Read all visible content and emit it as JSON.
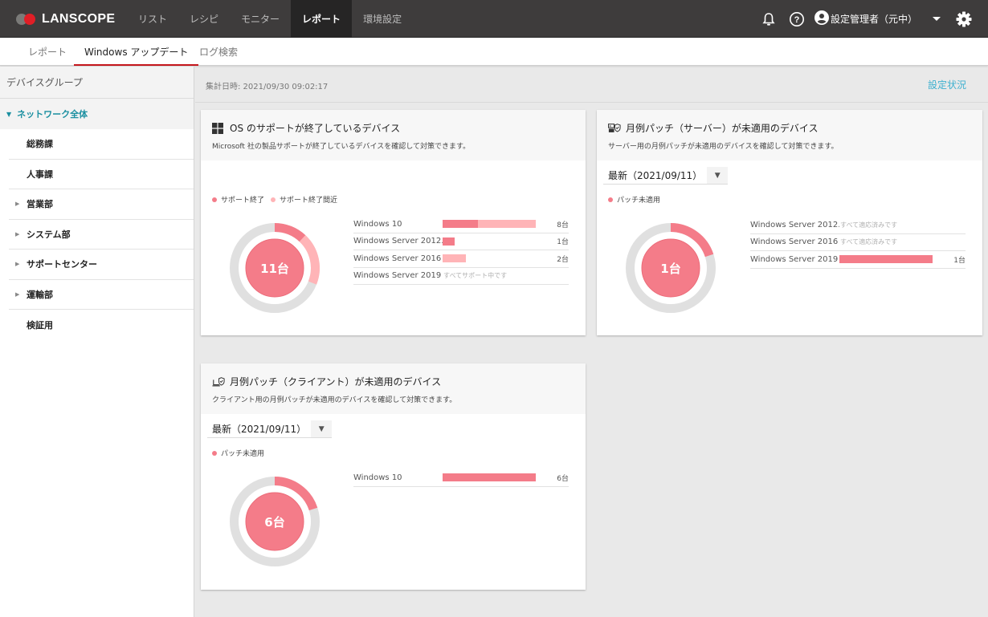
{
  "colors": {
    "ended": "#f47c89",
    "near_end": "#ffb4b7",
    "ring_bg": "#e0e0e0",
    "accent_teal": "#1a8fa0",
    "link_blue": "#3db0cf",
    "active_tab_underline": "#c4161c"
  },
  "app": {
    "logo_text": "LANSCOPE"
  },
  "nav": {
    "items": [
      {
        "label": "リスト"
      },
      {
        "label": "レシピ"
      },
      {
        "label": "モニター"
      },
      {
        "label": "レポート",
        "active": true
      },
      {
        "label": "環境設定"
      }
    ],
    "icons": [
      "bell-icon",
      "help-icon",
      "account-icon",
      "chevron-down-icon",
      "gear-icon"
    ],
    "user_name": "設定管理者（元中）"
  },
  "subtabs": [
    {
      "label": "レポート"
    },
    {
      "label": "Windows アップデート",
      "active": true
    },
    {
      "label": "ログ検索"
    }
  ],
  "sidebar": {
    "header": "デバイスグループ",
    "root": "ネットワーク全体",
    "items": [
      {
        "label": "総務課",
        "expandable": false
      },
      {
        "label": "人事課",
        "expandable": false
      },
      {
        "label": "営業部",
        "expandable": true
      },
      {
        "label": "システム部",
        "expandable": true
      },
      {
        "label": "サポートセンター",
        "expandable": true
      },
      {
        "label": "運輸部",
        "expandable": true
      },
      {
        "label": "検証用",
        "expandable": false
      }
    ]
  },
  "summary": {
    "timestamp": "集計日時: 2021/09/30 09:02:17",
    "settings_link": "設定状況"
  },
  "cards": {
    "os_support": {
      "title": "OS のサポートが終了しているデバイス",
      "description": "Microsoft 社の製品サポートが終了しているデバイスを確認して対策できます。",
      "legend": [
        "サポート終了",
        "サポート終了間近"
      ],
      "total_label": "11台",
      "ring_fractions": {
        "ended": 0.12,
        "near_end": 0.19
      },
      "rows": [
        {
          "os": "Windows 10",
          "ended": 3,
          "near_end": 5,
          "count_label": "8台",
          "note": ""
        },
        {
          "os": "Windows Server 2012...",
          "ended": 1,
          "near_end": 0,
          "count_label": "1台",
          "note": ""
        },
        {
          "os": "Windows Server 2016",
          "ended": 0,
          "near_end": 2,
          "count_label": "2台",
          "note": ""
        },
        {
          "os": "Windows Server 2019",
          "ended": 0,
          "near_end": 0,
          "count_label": "",
          "note": "すべてサポート中です"
        }
      ],
      "max": 8
    },
    "server_patch": {
      "title": "月例パッチ（サーバー）が未適用のデバイス",
      "description": "サーバー用の月例パッチが未適用のデバイスを確認して対策できます。",
      "select_value": "最新（2021/09/11）",
      "legend": [
        "パッチ未適用"
      ],
      "total_label": "1台",
      "ring_fractions": {
        "ended": 0.2
      },
      "rows": [
        {
          "os": "Windows Server 2012...",
          "ended": 0,
          "near_end": 0,
          "count_label": "",
          "note": "すべて適応済みです"
        },
        {
          "os": "Windows Server 2016",
          "ended": 0,
          "near_end": 0,
          "count_label": "",
          "note": "すべて適応済みです"
        },
        {
          "os": "Windows Server 2019",
          "ended": 1,
          "near_end": 0,
          "count_label": "1台",
          "note": ""
        }
      ],
      "max": 1
    },
    "client_patch": {
      "title": "月例パッチ（クライアント）が未適用のデバイス",
      "description": "クライアント用の月例パッチが未適用のデバイスを確認して対策できます。",
      "select_value": "最新（2021/09/11）",
      "legend": [
        "パッチ未適用"
      ],
      "total_label": "6台",
      "ring_fractions": {
        "ended": 0.2
      },
      "rows": [
        {
          "os": "Windows 10",
          "ended": 6,
          "near_end": 0,
          "count_label": "6台",
          "note": ""
        }
      ],
      "max": 6
    }
  }
}
